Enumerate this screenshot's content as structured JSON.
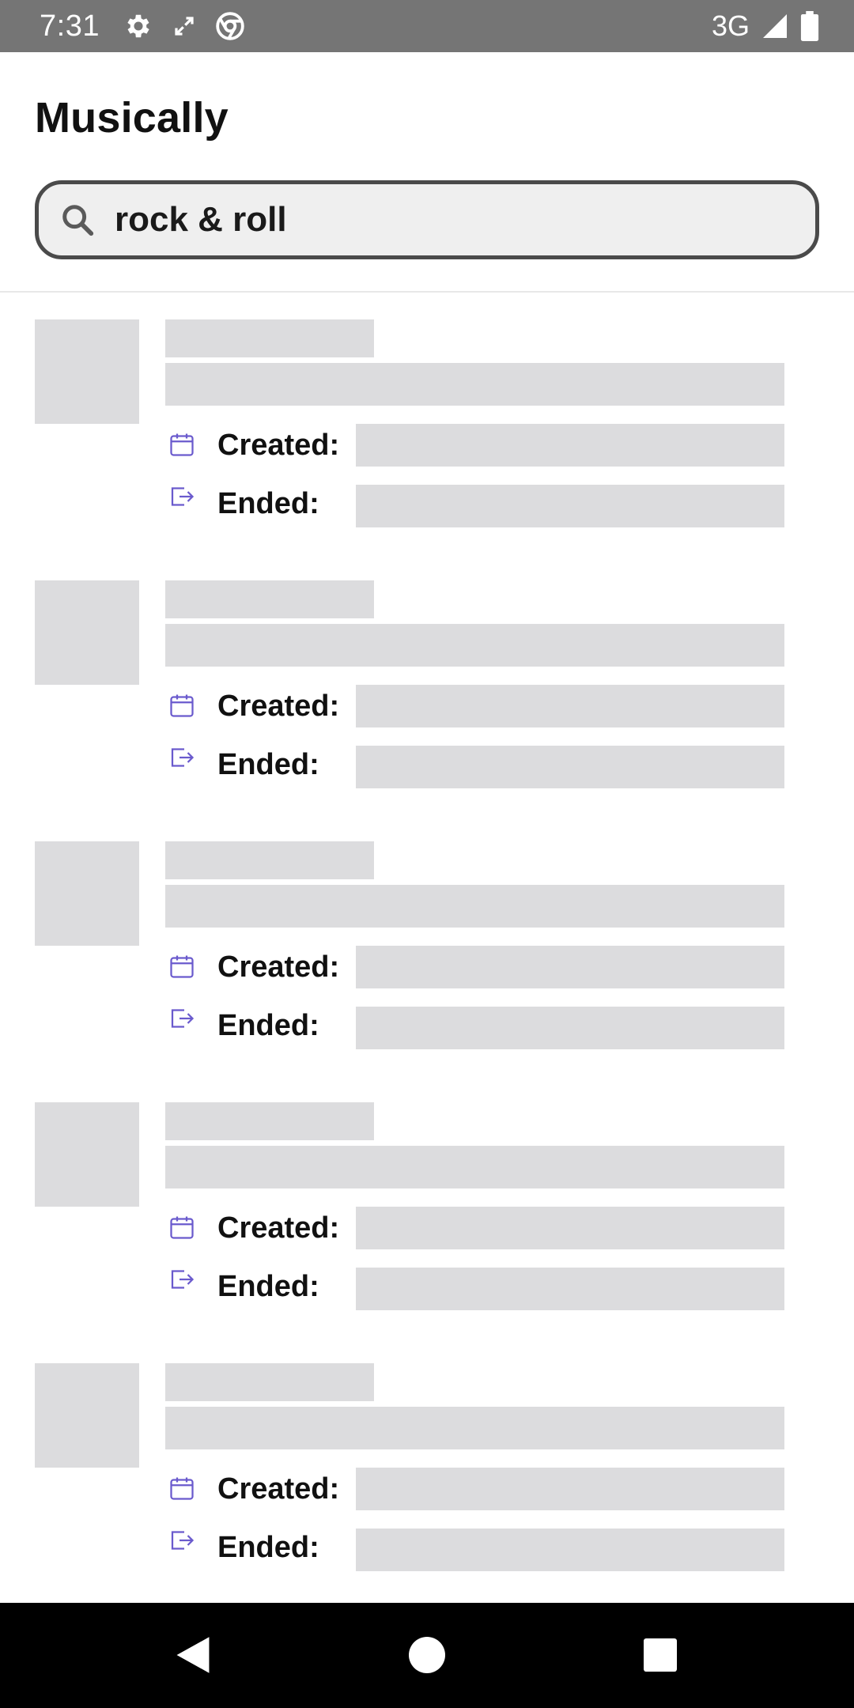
{
  "status_bar": {
    "time": "7:31",
    "network": "3G",
    "left_icons": [
      "gear-icon",
      "fullscreen-icon",
      "chrome-icon"
    ],
    "right_icons": [
      "signal-icon",
      "battery-icon"
    ]
  },
  "header": {
    "title": "Musically"
  },
  "search": {
    "value": "rock & roll",
    "icon": "search-icon"
  },
  "list": {
    "items": [
      {
        "created_label": "Created:",
        "ended_label": "Ended:"
      },
      {
        "created_label": "Created:",
        "ended_label": "Ended:"
      },
      {
        "created_label": "Created:",
        "ended_label": "Ended:"
      },
      {
        "created_label": "Created:",
        "ended_label": "Ended:"
      },
      {
        "created_label": "Created:",
        "ended_label": "Ended:"
      }
    ]
  },
  "colors": {
    "accent_icon": "#6a5acd",
    "skeleton": "#dcdcde",
    "status_bar": "#757575",
    "nav_bar": "#000000"
  },
  "nav_bar": {
    "buttons": [
      "back-icon",
      "home-icon",
      "recents-icon"
    ]
  }
}
